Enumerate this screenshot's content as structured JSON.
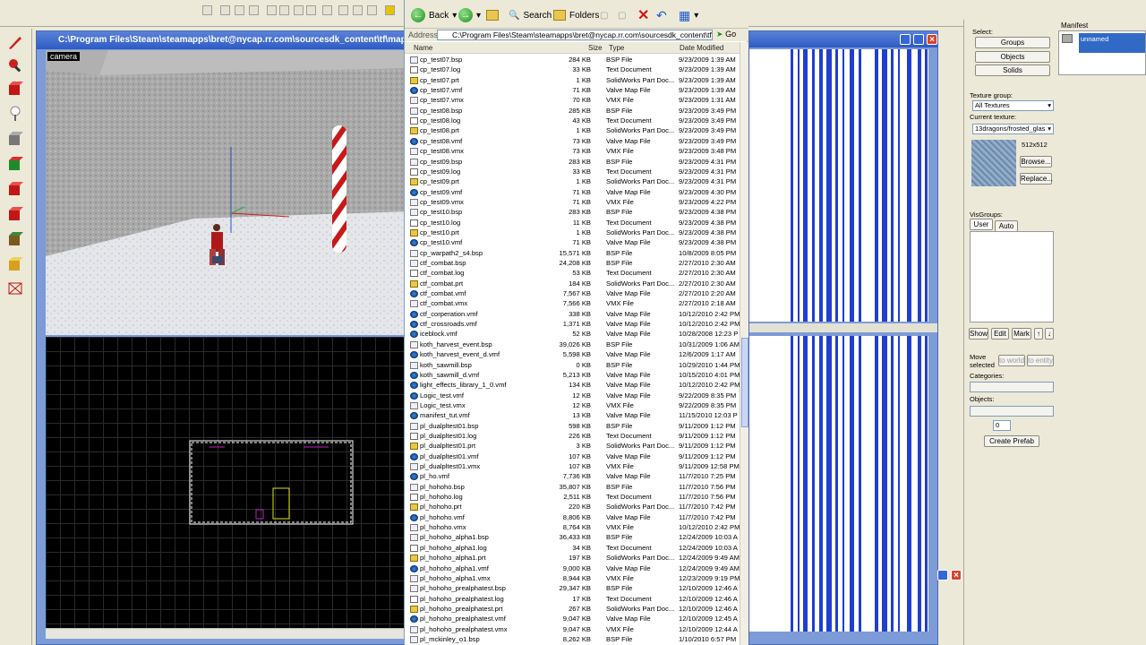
{
  "editor": {
    "title": "C:\\Program Files\\Steam\\steamapps\\bret@nycap.rr.com\\sourcesdk_content\\tf\\mapsrc\\manifest",
    "camera_label": "camera"
  },
  "explorer": {
    "toolbar": {
      "back": "Back",
      "search": "Search",
      "folders": "Folders"
    },
    "address_label": "Address",
    "address": "C:\\Program Files\\Steam\\steamapps\\bret@nycap.rr.com\\sourcesdk_content\\tf\\mapsrc",
    "go": "Go",
    "columns": {
      "name": "Name",
      "size": "Size",
      "type": "Type",
      "date": "Date Modified"
    },
    "files": [
      [
        "cp_test07.bsp",
        "284 KB",
        "BSP File",
        "9/23/2009 1:39 AM",
        "bsp"
      ],
      [
        "cp_test07.log",
        "33 KB",
        "Text Document",
        "9/23/2009 1:39 AM",
        "log"
      ],
      [
        "cp_test07.prt",
        "1 KB",
        "SolidWorks Part Doc...",
        "9/23/2009 1:39 AM",
        "prt"
      ],
      [
        "cp_test07.vmf",
        "71 KB",
        "Valve Map File",
        "9/23/2009 1:39 AM",
        "vmf"
      ],
      [
        "cp_test07.vmx",
        "70 KB",
        "VMX File",
        "9/23/2009 1:31 AM",
        "bsp"
      ],
      [
        "cp_test08.bsp",
        "285 KB",
        "BSP File",
        "9/23/2009 3:49 PM",
        "bsp"
      ],
      [
        "cp_test08.log",
        "43 KB",
        "Text Document",
        "9/23/2009 3:49 PM",
        "log"
      ],
      [
        "cp_test08.prt",
        "1 KB",
        "SolidWorks Part Doc...",
        "9/23/2009 3:49 PM",
        "prt"
      ],
      [
        "cp_test08.vmf",
        "73 KB",
        "Valve Map File",
        "9/23/2009 3:49 PM",
        "vmf"
      ],
      [
        "cp_test08.vmx",
        "73 KB",
        "VMX File",
        "9/23/2009 3:48 PM",
        "bsp"
      ],
      [
        "cp_test09.bsp",
        "283 KB",
        "BSP File",
        "9/23/2009 4:31 PM",
        "bsp"
      ],
      [
        "cp_test09.log",
        "33 KB",
        "Text Document",
        "9/23/2009 4:31 PM",
        "log"
      ],
      [
        "cp_test09.prt",
        "1 KB",
        "SolidWorks Part Doc...",
        "9/23/2009 4:31 PM",
        "prt"
      ],
      [
        "cp_test09.vmf",
        "71 KB",
        "Valve Map File",
        "9/23/2009 4:30 PM",
        "vmf"
      ],
      [
        "cp_test09.vmx",
        "71 KB",
        "VMX File",
        "9/23/2009 4:22 PM",
        "bsp"
      ],
      [
        "cp_test10.bsp",
        "283 KB",
        "BSP File",
        "9/23/2009 4:38 PM",
        "bsp"
      ],
      [
        "cp_test10.log",
        "11 KB",
        "Text Document",
        "9/23/2009 4:38 PM",
        "log"
      ],
      [
        "cp_test10.prt",
        "1 KB",
        "SolidWorks Part Doc...",
        "9/23/2009 4:38 PM",
        "prt"
      ],
      [
        "cp_test10.vmf",
        "71 KB",
        "Valve Map File",
        "9/23/2009 4:38 PM",
        "vmf"
      ],
      [
        "cp_warpath2_s4.bsp",
        "15,571 KB",
        "BSP File",
        "10/8/2009 8:05 PM",
        "bsp"
      ],
      [
        "ctf_combat.bsp",
        "24,208 KB",
        "BSP File",
        "2/27/2010 2:30 AM",
        "bsp"
      ],
      [
        "ctf_combat.log",
        "53 KB",
        "Text Document",
        "2/27/2010 2:30 AM",
        "log"
      ],
      [
        "ctf_combat.prt",
        "184 KB",
        "SolidWorks Part Doc...",
        "2/27/2010 2:30 AM",
        "prt"
      ],
      [
        "ctf_combat.vmf",
        "7,567 KB",
        "Valve Map File",
        "2/27/2010 2:20 AM",
        "vmf"
      ],
      [
        "ctf_combat.vmx",
        "7,566 KB",
        "VMX File",
        "2/27/2010 2:18 AM",
        "bsp"
      ],
      [
        "ctf_corperation.vmf",
        "338 KB",
        "Valve Map File",
        "10/12/2010 2:42 PM",
        "vmf"
      ],
      [
        "ctf_crossroads.vmf",
        "1,371 KB",
        "Valve Map File",
        "10/12/2010 2:42 PM",
        "vmf"
      ],
      [
        "iceblock.vmf",
        "52 KB",
        "Valve Map File",
        "10/28/2008 12:23 P",
        "vmf"
      ],
      [
        "koth_harvest_event.bsp",
        "39,026 KB",
        "BSP File",
        "10/31/2009 1:06 AM",
        "bsp"
      ],
      [
        "koth_harvest_event_d.vmf",
        "5,598 KB",
        "Valve Map File",
        "12/6/2009 1:17 AM",
        "vmf"
      ],
      [
        "koth_sawmill.bsp",
        "0 KB",
        "BSP File",
        "10/29/2010 1:44 PM",
        "bsp"
      ],
      [
        "koth_sawmill_d.vmf",
        "5,213 KB",
        "Valve Map File",
        "10/15/2010 4:01 PM",
        "vmf"
      ],
      [
        "light_effects_library_1_0.vmf",
        "134 KB",
        "Valve Map File",
        "10/12/2010 2:42 PM",
        "vmf"
      ],
      [
        "Logic_test.vmf",
        "12 KB",
        "Valve Map File",
        "9/22/2009 8:35 PM",
        "vmf"
      ],
      [
        "Logic_test.vmx",
        "12 KB",
        "VMX File",
        "9/22/2009 8:35 PM",
        "bsp"
      ],
      [
        "manifest_tut.vmf",
        "13 KB",
        "Valve Map File",
        "11/15/2010 12:03 P",
        "vmf"
      ],
      [
        "pl_dualpltest01.bsp",
        "598 KB",
        "BSP File",
        "9/11/2009 1:12 PM",
        "bsp"
      ],
      [
        "pl_dualpltest01.log",
        "226 KB",
        "Text Document",
        "9/11/2009 1:12 PM",
        "log"
      ],
      [
        "pl_dualpltest01.prt",
        "3 KB",
        "SolidWorks Part Doc...",
        "9/11/2009 1:12 PM",
        "prt"
      ],
      [
        "pl_dualpltest01.vmf",
        "107 KB",
        "Valve Map File",
        "9/11/2009 1:12 PM",
        "vmf"
      ],
      [
        "pl_dualpltest01.vmx",
        "107 KB",
        "VMX File",
        "9/11/2009 12:58 PM",
        "bsp"
      ],
      [
        "pl_ho.vmf",
        "7,736 KB",
        "Valve Map File",
        "11/7/2010 7:25 PM",
        "vmf"
      ],
      [
        "pl_hohoho.bsp",
        "35,807 KB",
        "BSP File",
        "11/7/2010 7:56 PM",
        "bsp"
      ],
      [
        "pl_hohoho.log",
        "2,511 KB",
        "Text Document",
        "11/7/2010 7:56 PM",
        "log"
      ],
      [
        "pl_hohoho.prt",
        "220 KB",
        "SolidWorks Part Doc...",
        "11/7/2010 7:42 PM",
        "prt"
      ],
      [
        "pl_hohoho.vmf",
        "8,806 KB",
        "Valve Map File",
        "11/7/2010 7:42 PM",
        "vmf"
      ],
      [
        "pl_hohoho.vmx",
        "8,764 KB",
        "VMX File",
        "10/12/2010 2:42 PM",
        "bsp"
      ],
      [
        "pl_hohoho_alpha1.bsp",
        "36,433 KB",
        "BSP File",
        "12/24/2009 10:03 A",
        "bsp"
      ],
      [
        "pl_hohoho_alpha1.log",
        "34 KB",
        "Text Document",
        "12/24/2009 10:03 A",
        "log"
      ],
      [
        "pl_hohoho_alpha1.prt",
        "197 KB",
        "SolidWorks Part Doc...",
        "12/24/2009 9:49 AM",
        "prt"
      ],
      [
        "pl_hohoho_alpha1.vmf",
        "9,000 KB",
        "Valve Map File",
        "12/24/2009 9:49 AM",
        "vmf"
      ],
      [
        "pl_hohoho_alpha1.vmx",
        "8,944 KB",
        "VMX File",
        "12/23/2009 9:19 PM",
        "bsp"
      ],
      [
        "pl_hohoho_prealphatest.bsp",
        "29,347 KB",
        "BSP File",
        "12/10/2009 12:46 A",
        "bsp"
      ],
      [
        "pl_hohoho_prealphatest.log",
        "17 KB",
        "Text Document",
        "12/10/2009 12:46 A",
        "log"
      ],
      [
        "pl_hohoho_prealphatest.prt",
        "267 KB",
        "SolidWorks Part Doc...",
        "12/10/2009 12:46 A",
        "prt"
      ],
      [
        "pl_hohoho_prealphatest.vmf",
        "9,047 KB",
        "Valve Map File",
        "12/10/2009 12:45 A",
        "vmf"
      ],
      [
        "pl_hohoho_prealphatest.vmx",
        "9,047 KB",
        "VMX File",
        "12/10/2009 12:44 A",
        "bsp"
      ],
      [
        "pl_mckinley_o1.bsp",
        "8,262 KB",
        "BSP File",
        "1/10/2010 6:57 PM",
        "bsp"
      ]
    ]
  },
  "properties": {
    "select_label": "Select:",
    "groups": "Groups",
    "objects": "Objects",
    "solids": "Solids",
    "texture_group_label": "Texture group:",
    "texture_group": "All Textures",
    "current_texture_label": "Current texture:",
    "current_texture": "13dragons/frosted_glas",
    "texture_size": "512x512",
    "browse": "Browse...",
    "replace": "Replace...",
    "visgroups_label": "VisGroups:",
    "tab_user": "User",
    "tab_auto": "Auto",
    "show": "Show",
    "edit": "Edit",
    "mark": "Mark",
    "move_selected": "Move selected",
    "to_world": "to world",
    "to_entity": "to entity",
    "categories_label": "Categories:",
    "objects_label": "Objects:",
    "objects_count": "0",
    "create_prefab": "Create Prefab"
  },
  "manifest": {
    "label": "Manifest",
    "item": "unnamed"
  }
}
